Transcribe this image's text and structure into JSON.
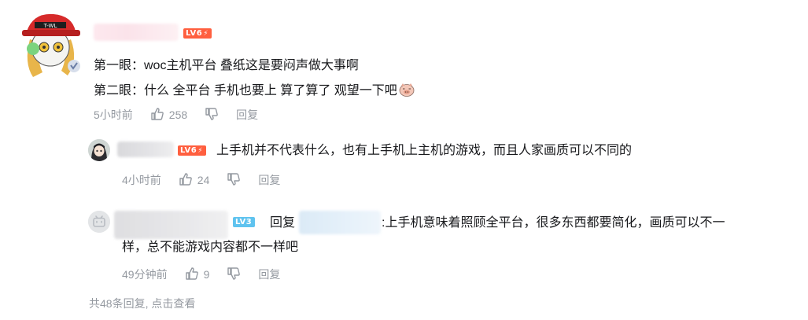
{
  "comment": {
    "level": "LV6",
    "lines": [
      "第一眼：woc主机平台 叠纸这是要闷声做大事啊",
      "第二眼：什么 全平台 手机也要上 算了算了 观望一下吧"
    ],
    "time": "5小时前",
    "likes": "258",
    "reply_label": "回复"
  },
  "replies": [
    {
      "level": "LV6",
      "text": "上手机并不代表什么，也有上手机上主机的游戏，而且人家画质可以不同的",
      "time": "4小时前",
      "likes": "24",
      "reply_label": "回复"
    },
    {
      "level": "LV3",
      "prefix": "回复",
      "text_line1": ":上手机意味着照顾全平台，很多东西都要简化，画质可以不一",
      "text_line2": "样，总不能游戏内容都不一样吧",
      "time": "49分钟前",
      "likes": "9",
      "reply_label": "回复"
    }
  ],
  "footer": "共48条回复, 点击查看",
  "colors": {
    "level6": "#ff5f3f",
    "level3": "#5fc3ef",
    "meta": "#9499a0"
  },
  "icons": [
    "avatar-red-cap",
    "avatar-anime-girl",
    "avatar-bilibili-tv",
    "thumb-up-icon",
    "thumb-down-icon",
    "pig-emoji-icon",
    "verified-badge-icon"
  ]
}
